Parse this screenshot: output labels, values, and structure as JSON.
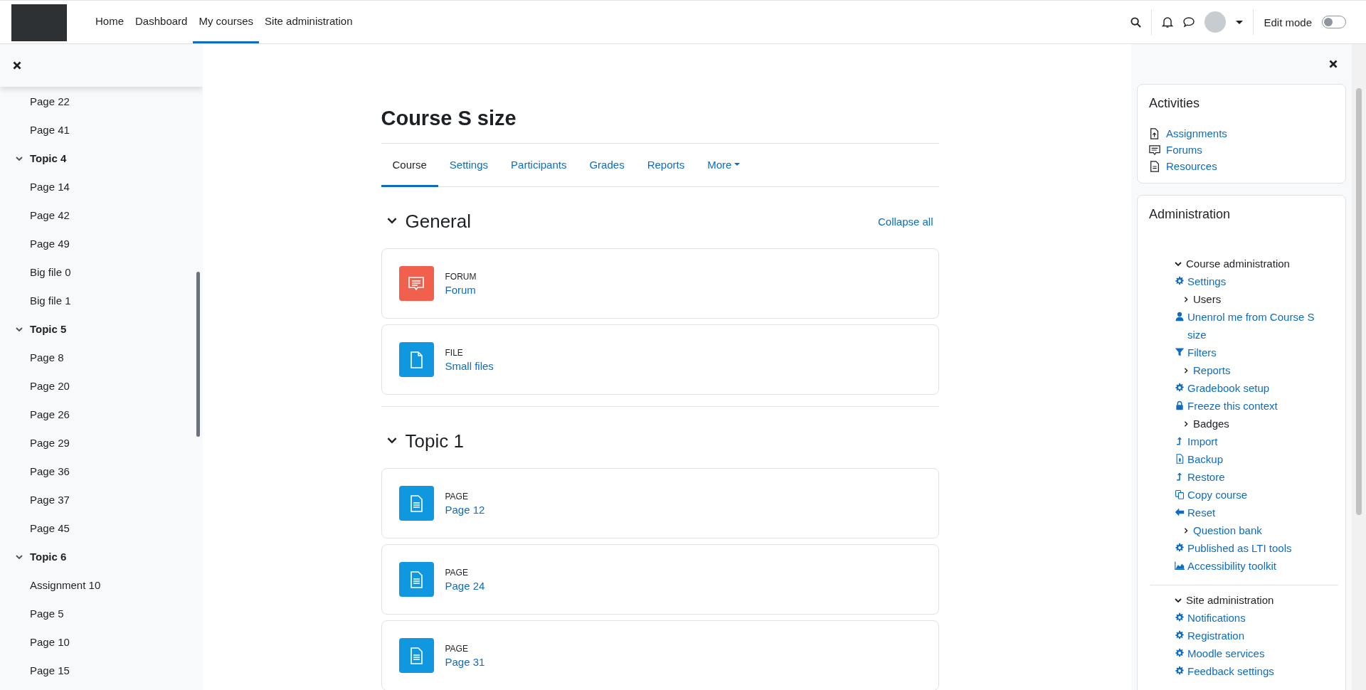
{
  "header": {
    "nav": [
      {
        "label": "Home",
        "selected": false
      },
      {
        "label": "Dashboard",
        "selected": false
      },
      {
        "label": "My courses",
        "selected": true
      },
      {
        "label": "Site administration",
        "selected": false
      }
    ],
    "edit_mode": {
      "label": "Edit mode",
      "on": false
    }
  },
  "course_index": {
    "items": [
      {
        "kind": "page",
        "label": "Page 22"
      },
      {
        "kind": "page",
        "label": "Page 41"
      },
      {
        "kind": "section",
        "label": "Topic 4",
        "expanded": true,
        "children": [
          {
            "kind": "page",
            "label": "Page 14"
          },
          {
            "kind": "page",
            "label": "Page 42"
          },
          {
            "kind": "page",
            "label": "Page 49"
          },
          {
            "kind": "page",
            "label": "Big file 0"
          },
          {
            "kind": "page",
            "label": "Big file 1"
          }
        ]
      },
      {
        "kind": "section",
        "label": "Topic 5",
        "expanded": true,
        "children": [
          {
            "kind": "page",
            "label": "Page 8"
          },
          {
            "kind": "page",
            "label": "Page 20"
          },
          {
            "kind": "page",
            "label": "Page 26"
          },
          {
            "kind": "page",
            "label": "Page 29"
          },
          {
            "kind": "page",
            "label": "Page 36"
          },
          {
            "kind": "page",
            "label": "Page 37"
          },
          {
            "kind": "page",
            "label": "Page 45"
          }
        ]
      },
      {
        "kind": "section",
        "label": "Topic 6",
        "expanded": true,
        "children": [
          {
            "kind": "page",
            "label": "Assignment 10"
          },
          {
            "kind": "page",
            "label": "Page 5"
          },
          {
            "kind": "page",
            "label": "Page 10"
          },
          {
            "kind": "page",
            "label": "Page 15"
          }
        ]
      }
    ]
  },
  "course": {
    "title": "Course S size",
    "tabs": [
      {
        "label": "Course",
        "selected": true
      },
      {
        "label": "Settings",
        "selected": false
      },
      {
        "label": "Participants",
        "selected": false
      },
      {
        "label": "Grades",
        "selected": false
      },
      {
        "label": "Reports",
        "selected": false
      },
      {
        "label": "More",
        "selected": false
      }
    ],
    "collapse_all": "Collapse all",
    "sections": [
      {
        "title": "General",
        "expanded": true,
        "activities": [
          {
            "kind": "forum",
            "type": "FORUM",
            "name": "Forum"
          },
          {
            "kind": "file",
            "type": "FILE",
            "name": "Small files"
          }
        ]
      },
      {
        "title": "Topic 1",
        "expanded": true,
        "activities": [
          {
            "kind": "page",
            "type": "PAGE",
            "name": "Page 12"
          },
          {
            "kind": "page",
            "type": "PAGE",
            "name": "Page 24"
          },
          {
            "kind": "page",
            "type": "PAGE",
            "name": "Page 31"
          }
        ]
      }
    ]
  },
  "blocks": {
    "activities": {
      "title": "Activities",
      "items": [
        {
          "kind": "assignment",
          "label": "Assignments"
        },
        {
          "kind": "forum",
          "label": "Forums"
        },
        {
          "kind": "resource",
          "label": "Resources"
        }
      ]
    },
    "administration": {
      "title": "Administration",
      "groups": [
        {
          "label": "Course administration",
          "expanded": true,
          "items": [
            {
              "kind": "gear",
              "label": "Settings"
            },
            {
              "kind": "branch",
              "label": "Users"
            },
            {
              "kind": "user",
              "label": "Unenrol me from Course S size"
            },
            {
              "kind": "filter",
              "label": "Filters"
            },
            {
              "kind": "branch-link",
              "label": "Reports"
            },
            {
              "kind": "gear",
              "label": "Gradebook setup"
            },
            {
              "kind": "lock",
              "label": "Freeze this context"
            },
            {
              "kind": "branch",
              "label": "Badges"
            },
            {
              "kind": "upload",
              "label": "Import"
            },
            {
              "kind": "backup",
              "label": "Backup"
            },
            {
              "kind": "upload",
              "label": "Restore"
            },
            {
              "kind": "copy",
              "label": "Copy course"
            },
            {
              "kind": "back",
              "label": "Reset"
            },
            {
              "kind": "branch-link",
              "label": "Question bank"
            },
            {
              "kind": "gear",
              "label": "Published as LTI tools"
            },
            {
              "kind": "chart",
              "label": "Accessibility toolkit"
            }
          ]
        },
        {
          "label": "Site administration",
          "expanded": true,
          "items": [
            {
              "kind": "gear",
              "label": "Notifications"
            },
            {
              "kind": "gear",
              "label": "Registration"
            },
            {
              "kind": "gear",
              "label": "Moodle services"
            },
            {
              "kind": "gear",
              "label": "Feedback settings"
            }
          ]
        }
      ]
    }
  }
}
